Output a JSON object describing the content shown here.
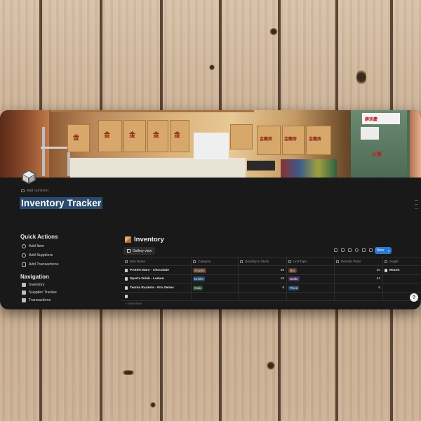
{
  "colors": {
    "window_bg": "#191919",
    "title_highlight": "#2a4a6e",
    "new_button": "#2a7bd6",
    "tag_snacks": "#5a3b2a",
    "tag_drinks": "#284b6b",
    "tag_gear": "#2f4f34",
    "tag_box": "#5a3b2a",
    "tag_bottle": "#4a3064",
    "tag_piece": "#284b6b"
  },
  "page": {
    "add_comment": "Add comment",
    "title": "Inventory Tracker",
    "icon": "cube-logo-icon"
  },
  "quick_actions": {
    "heading": "Quick Actions",
    "items": [
      {
        "label": "Add Item",
        "icon": "plus-circle-icon"
      },
      {
        "label": "Add Suppliers",
        "icon": "plus-circle-icon"
      },
      {
        "label": "Add Transactions",
        "icon": "calendar-icon"
      }
    ]
  },
  "navigation": {
    "heading": "Navigation",
    "items": [
      {
        "label": "Inventory",
        "icon": "page-icon"
      },
      {
        "label": "Supplier Tracker",
        "icon": "page-icon"
      },
      {
        "label": "Transactions",
        "icon": "page-icon"
      }
    ]
  },
  "database": {
    "title": "Inventory",
    "view_tab": "Gallery view",
    "new_button": "New",
    "new_item": "+ New item",
    "columns": [
      "Item Name",
      "Category",
      "Quantity in Stock",
      "Unit Type",
      "Reorder Point",
      "Suppli"
    ],
    "rows": [
      {
        "name": "Protein Bars - Chocolate",
        "category": "Snacks",
        "quantity": "45",
        "unit": "Box",
        "reorder": "20",
        "supplier": "Mount"
      },
      {
        "name": "Sports Drink - Lemon",
        "category": "Drinks",
        "quantity": "18",
        "unit": "Bottle",
        "reorder": "24",
        "supplier": ""
      },
      {
        "name": "Tennis Rackets - Pro Series",
        "category": "Gear",
        "quantity": "8",
        "unit": "Piece",
        "reorder": "5",
        "supplier": ""
      }
    ]
  },
  "help": "?"
}
